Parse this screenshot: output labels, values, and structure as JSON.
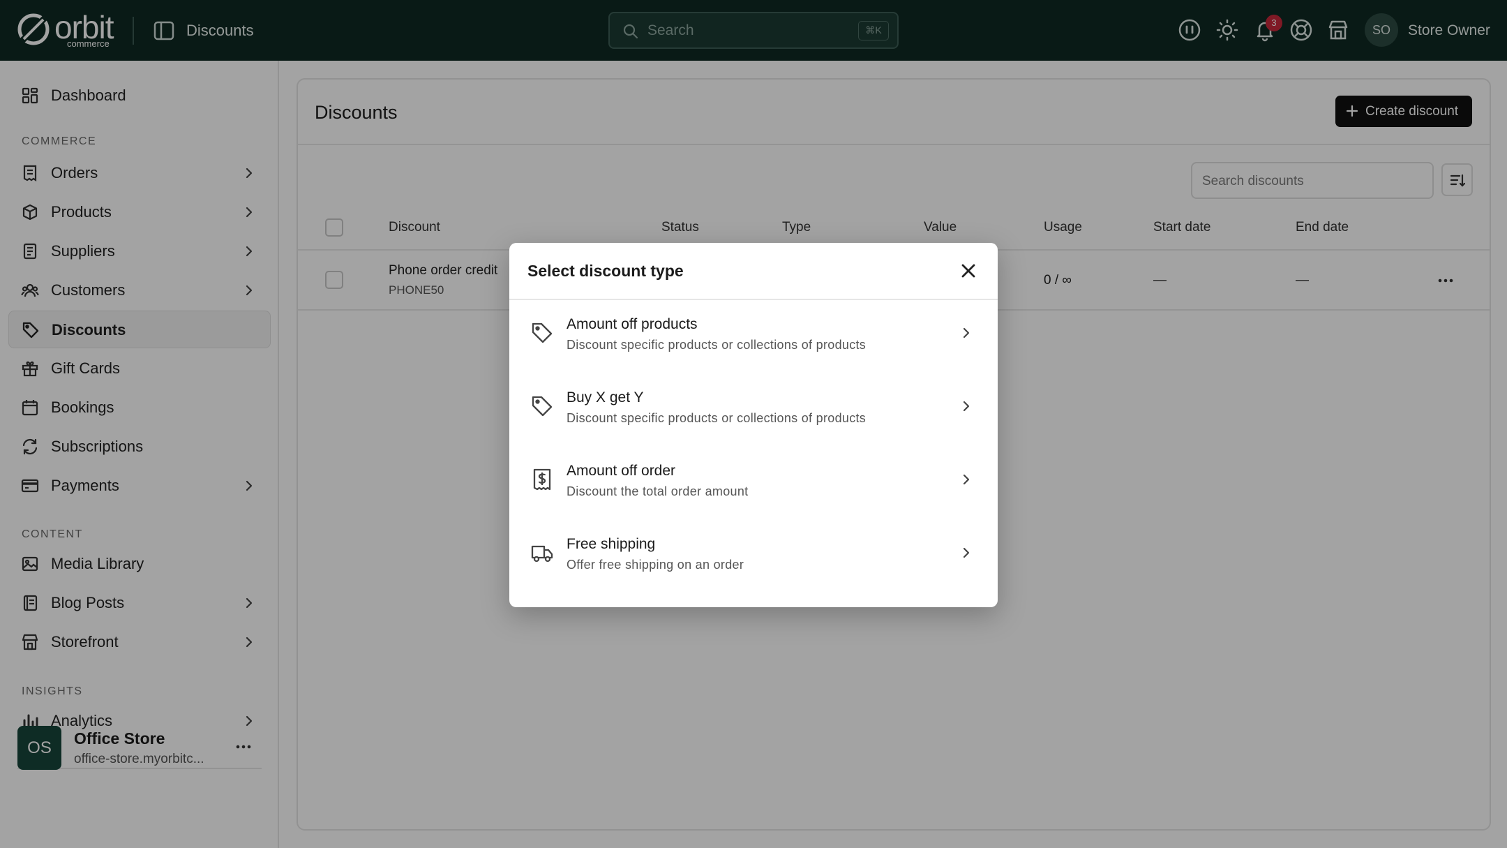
{
  "topbar": {
    "logo_text": "orbit",
    "logo_sub": "commerce",
    "title": "Discounts",
    "search_placeholder": "Search",
    "search_shortcut": "⌘K",
    "notification_count": "3",
    "avatar_initials": "SO",
    "user_name": "Store Owner"
  },
  "sidebar": {
    "sections": {
      "commerce": "COMMERCE",
      "content": "CONTENT",
      "insights": "INSIGHTS"
    },
    "items": [
      {
        "label": "Dashboard",
        "icon": "dashboard-icon"
      },
      {
        "label": "Orders",
        "icon": "orders-icon",
        "has_children": true
      },
      {
        "label": "Products",
        "icon": "box-icon",
        "has_children": true
      },
      {
        "label": "Suppliers",
        "icon": "suppliers-icon",
        "has_children": true
      },
      {
        "label": "Customers",
        "icon": "users-icon",
        "has_children": true
      },
      {
        "label": "Discounts",
        "icon": "tag-icon",
        "active": true
      },
      {
        "label": "Gift Cards",
        "icon": "gift-icon"
      },
      {
        "label": "Bookings",
        "icon": "calendar-icon"
      },
      {
        "label": "Subscriptions",
        "icon": "refresh-icon"
      },
      {
        "label": "Payments",
        "icon": "credit-card-icon",
        "has_children": true
      },
      {
        "label": "Media Library",
        "icon": "image-icon"
      },
      {
        "label": "Blog Posts",
        "icon": "book-icon",
        "has_children": true
      },
      {
        "label": "Storefront",
        "icon": "store-icon",
        "has_children": true
      },
      {
        "label": "Analytics",
        "icon": "bar-chart-icon",
        "has_children": true
      }
    ],
    "store": {
      "initials": "OS",
      "name": "Office Store",
      "url": "office-store.myorbitc..."
    }
  },
  "main": {
    "title": "Discounts",
    "create_label": "Create discount",
    "search_placeholder": "Search discounts",
    "columns": [
      "Discount",
      "Status",
      "Type",
      "Value",
      "Usage",
      "Start date",
      "End date"
    ],
    "rows": [
      {
        "name": "Phone order credit",
        "code": "PHONE50",
        "usage": "0 / ∞",
        "start": "—",
        "end": "—"
      }
    ]
  },
  "dialog": {
    "title": "Select discount type",
    "options": [
      {
        "title": "Amount off products",
        "desc": "Discount specific products or collections of products",
        "icon": "tag-icon"
      },
      {
        "title": "Buy X get Y",
        "desc": "Discount specific products or collections of products",
        "icon": "tag-icon"
      },
      {
        "title": "Amount off order",
        "desc": "Discount the total order amount",
        "icon": "receipt-dollar-icon"
      },
      {
        "title": "Free shipping",
        "desc": "Offer free shipping on an order",
        "icon": "truck-icon"
      }
    ]
  },
  "colors": {
    "topbar": "#0f2a23",
    "accent": "#16453a",
    "badge": "#c7283a"
  }
}
